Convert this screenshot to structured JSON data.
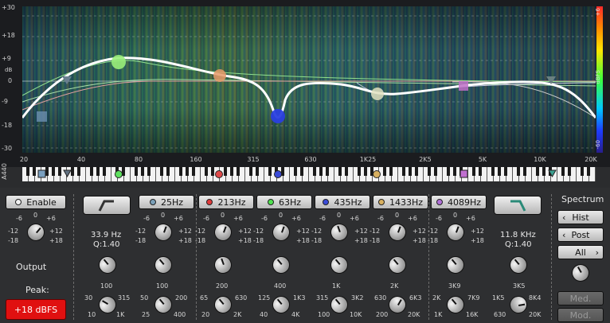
{
  "display": {
    "y_labels": [
      "+30",
      "+18",
      "+9",
      "0",
      "-9",
      "-18",
      "-30"
    ],
    "db_label": "dB",
    "x_labels": [
      "20",
      "40",
      "80",
      "160",
      "315",
      "630",
      "1K25",
      "2K5",
      "5K",
      "10K",
      "20K"
    ],
    "scale_top": "+6",
    "scale_mid": "dBFS",
    "scale_bottom": "-60",
    "a440": "A440"
  },
  "global": {
    "enable_label": "Enable",
    "output_label": "Output",
    "peak_label": "Peak:",
    "peak_value": "+18 dBFS",
    "gain_ticks": [
      "-6",
      "0",
      "+6",
      "-12",
      "+12",
      "-18",
      "+18"
    ]
  },
  "bands": [
    {
      "freq_btn": "25Hz",
      "color": "#7a9fb8",
      "gain_ticks": [
        "-6",
        "0",
        "+6",
        "-12",
        "+12",
        "-18",
        "+18"
      ],
      "center": "100",
      "ranges": [
        "50",
        "200",
        "25",
        "400"
      ]
    },
    {
      "freq_btn": "213Hz",
      "color": "#e03a3a",
      "gain_ticks": [
        "-6",
        "0",
        "+6",
        "-12",
        "+12",
        "-18",
        "+18"
      ],
      "center": "200",
      "ranges": [
        "65",
        "630",
        "20",
        "2K"
      ]
    },
    {
      "freq_btn": "63Hz",
      "color": "#4fe04f",
      "gain_ticks": [
        "-6",
        "0",
        "+6",
        "-12",
        "+12",
        "-18",
        "+18"
      ],
      "center": "400",
      "ranges": [
        "125",
        "1K3",
        "40",
        "4K"
      ]
    },
    {
      "freq_btn": "435Hz",
      "color": "#3a4bd8",
      "gain_ticks": [
        "-6",
        "0",
        "+6",
        "-12",
        "+12",
        "-18",
        "+18"
      ],
      "center": "1K",
      "ranges": [
        "315",
        "3K2",
        "100",
        "10K"
      ]
    },
    {
      "freq_btn": "1433Hz",
      "color": "#d8b060",
      "gain_ticks": [
        "-6",
        "0",
        "+6",
        "-12",
        "+12",
        "-18",
        "+18"
      ],
      "center": "2K",
      "ranges": [
        "630",
        "6K3",
        "200",
        "20K"
      ]
    },
    {
      "freq_btn": "4089Hz",
      "color": "#b070d8",
      "gain_ticks": [
        "-6",
        "0",
        "+6",
        "-12",
        "+12",
        "-18",
        "+18"
      ],
      "center": "3K9",
      "ranges": [
        "2K",
        "7K9",
        "1K",
        "16K"
      ]
    }
  ],
  "low_shelf": {
    "freq": "33.9 Hz",
    "q": "Q:1.40",
    "center": "100",
    "ranges": [
      "30",
      "315",
      "10",
      "1K"
    ]
  },
  "high_shelf": {
    "freq": "11.8 KHz",
    "q": "Q:1.40",
    "center": "3K5",
    "ranges": [
      "1K5",
      "8K4",
      "630",
      "20K"
    ]
  },
  "spectrum": {
    "title": "Spectrum",
    "hist": "Hist",
    "post": "Post",
    "all": "All",
    "med1": "Med.",
    "med2": "Mod."
  }
}
